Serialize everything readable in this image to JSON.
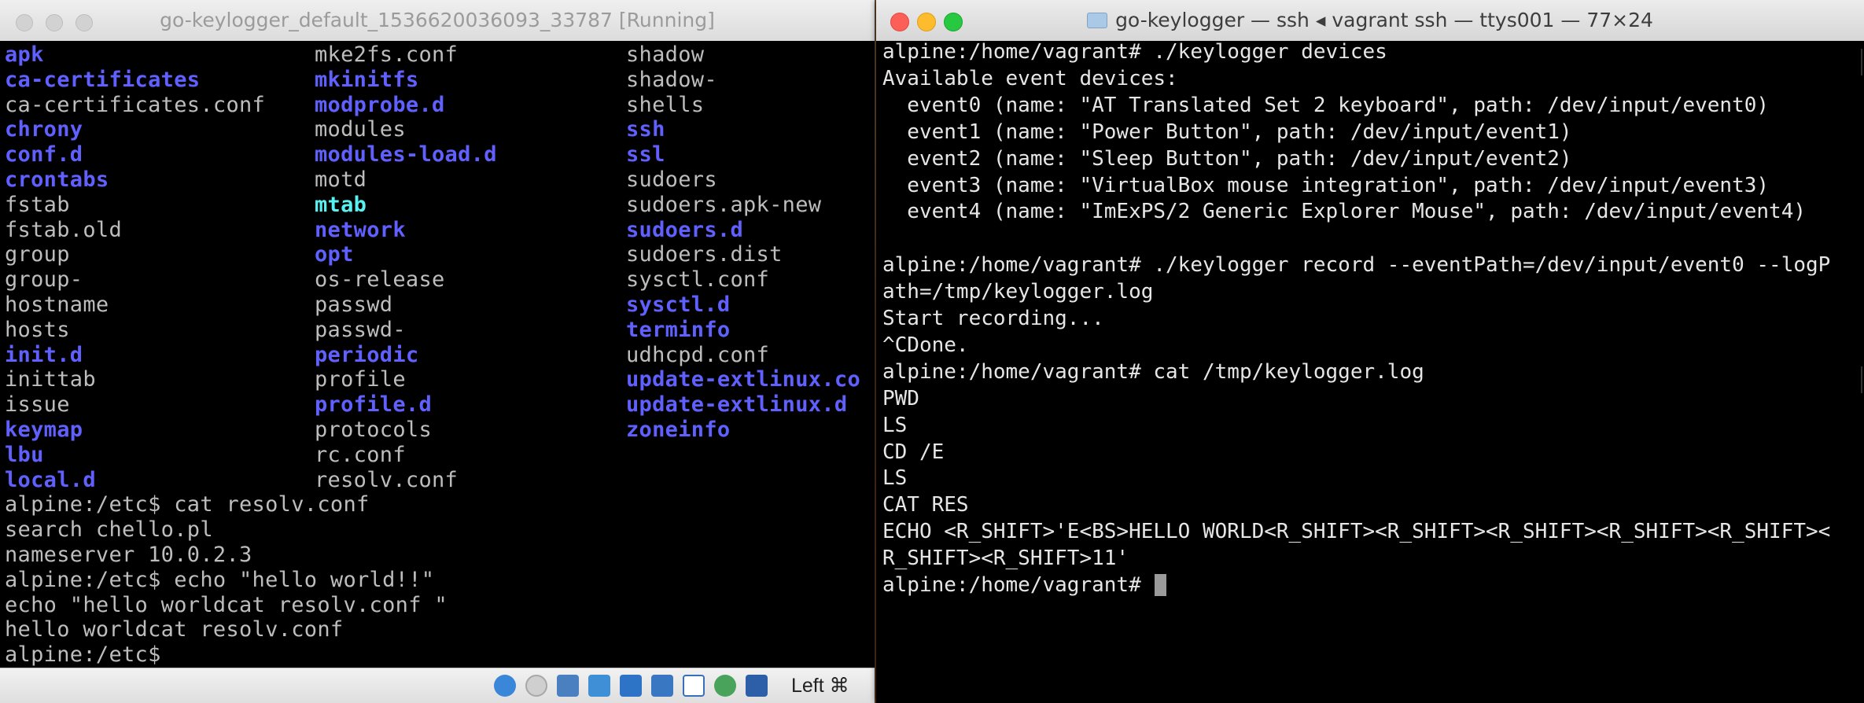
{
  "vbox": {
    "title": "go-keylogger_default_1536620036093_33787 [Running]",
    "listing": [
      [
        "apk",
        "mke2fs.conf",
        "shadow"
      ],
      [
        "ca-certificates",
        "mkinitfs",
        "shadow-"
      ],
      [
        "ca-certificates.conf",
        "modprobe.d",
        "shells"
      ],
      [
        "chrony",
        "modules",
        "ssh"
      ],
      [
        "conf.d",
        "modules-load.d",
        "ssl"
      ],
      [
        "crontabs",
        "motd",
        "sudoers"
      ],
      [
        "fstab",
        "mtab",
        "sudoers.apk-new"
      ],
      [
        "fstab.old",
        "network",
        "sudoers.d"
      ],
      [
        "group",
        "opt",
        "sudoers.dist"
      ],
      [
        "group-",
        "os-release",
        "sysctl.conf"
      ],
      [
        "hostname",
        "passwd",
        "sysctl.d"
      ],
      [
        "hosts",
        "passwd-",
        "terminfo"
      ],
      [
        "init.d",
        "periodic",
        "udhcpd.conf"
      ],
      [
        "inittab",
        "profile",
        "update-extlinux.co"
      ],
      [
        "issue",
        "profile.d",
        "update-extlinux.d"
      ],
      [
        "keymap",
        "protocols",
        "zoneinfo"
      ],
      [
        "lbu",
        "rc.conf",
        ""
      ],
      [
        "local.d",
        "resolv.conf",
        ""
      ]
    ],
    "listing_types": [
      [
        "dir",
        "file",
        "file"
      ],
      [
        "dir",
        "dir",
        "file"
      ],
      [
        "file",
        "dir",
        "file"
      ],
      [
        "dir",
        "file",
        "dir"
      ],
      [
        "dir",
        "dir",
        "dir"
      ],
      [
        "dir",
        "file",
        "file"
      ],
      [
        "file",
        "link",
        "file"
      ],
      [
        "file",
        "dir",
        "dir"
      ],
      [
        "file",
        "dir",
        "file"
      ],
      [
        "file",
        "file",
        "file"
      ],
      [
        "file",
        "file",
        "dir"
      ],
      [
        "file",
        "file",
        "dir"
      ],
      [
        "dir",
        "dir",
        "file"
      ],
      [
        "file",
        "file",
        "dir"
      ],
      [
        "file",
        "dir",
        "dir"
      ],
      [
        "dir",
        "file",
        "dir"
      ],
      [
        "dir",
        "file",
        "file"
      ],
      [
        "dir",
        "file",
        "file"
      ]
    ],
    "console_lines": [
      "alpine:/etc$ cat resolv.conf",
      "search chello.pl",
      "nameserver 10.0.2.3",
      "alpine:/etc$ echo \"hello world!!\"",
      "echo \"hello worldcat resolv.conf \"",
      "hello worldcat resolv.conf",
      "alpine:/etc$"
    ],
    "status": {
      "host_key_label": "Left ⌘",
      "icons": [
        "optical-drive-icon",
        "audio-icon",
        "network-icon",
        "shared-folder-icon",
        "display-icon",
        "usb-icon",
        "recording-icon",
        "cpu-icon",
        "mouse-integration-icon"
      ]
    }
  },
  "terminal": {
    "title": "go-keylogger — ssh ◂ vagrant ssh — ttys001 — 77×24",
    "lines": [
      "alpine:/home/vagrant# ./keylogger devices",
      "Available event devices:",
      "  event0 (name: \"AT Translated Set 2 keyboard\", path: /dev/input/event0)",
      "  event1 (name: \"Power Button\", path: /dev/input/event1)",
      "  event2 (name: \"Sleep Button\", path: /dev/input/event2)",
      "  event3 (name: \"VirtualBox mouse integration\", path: /dev/input/event3)",
      "  event4 (name: \"ImExPS/2 Generic Explorer Mouse\", path: /dev/input/event4)",
      "",
      "alpine:/home/vagrant# ./keylogger record --eventPath=/dev/input/event0 --logP",
      "ath=/tmp/keylogger.log",
      "Start recording...",
      "^CDone.",
      "alpine:/home/vagrant# cat /tmp/keylogger.log",
      "PWD",
      "LS",
      "CD /E",
      "LS",
      "CAT RES",
      "ECHO <R_SHIFT>'E<BS>HELLO WORLD<R_SHIFT><R_SHIFT><R_SHIFT><R_SHIFT><R_SHIFT><",
      "R_SHIFT><R_SHIFT>11'",
      "alpine:/home/vagrant# "
    ]
  },
  "colors": {
    "vbox_text": "#bdbdbd",
    "vbox_dir": "#6060ff",
    "vbox_link": "#5af0f0",
    "terminal_text": "#e6e6e6",
    "close": "#fc5f57",
    "minimize": "#fdbc2e",
    "zoom": "#28c840"
  }
}
